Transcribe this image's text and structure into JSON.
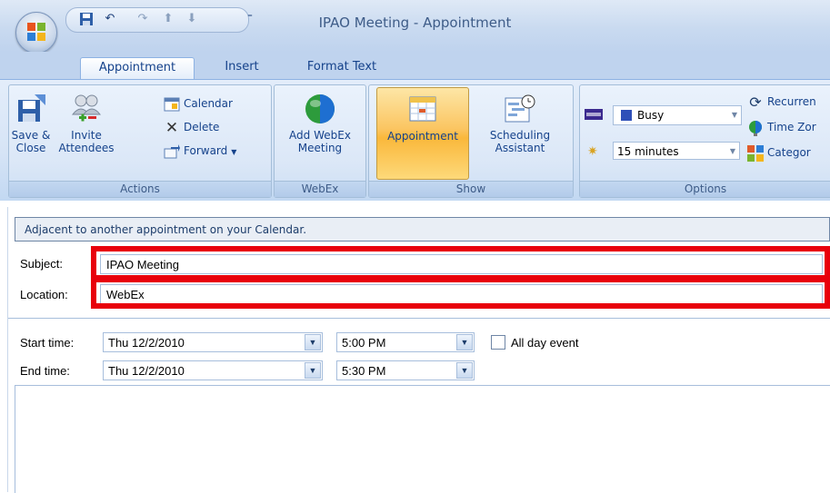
{
  "window": {
    "title": "IPAO Meeting - Appointment"
  },
  "quick_access": {
    "icons": [
      "save-icon",
      "undo-icon",
      "redo-icon",
      "up-arrow-icon",
      "down-arrow-icon",
      "customize-icon"
    ]
  },
  "tabs": [
    {
      "label": "Appointment",
      "active": true
    },
    {
      "label": "Insert"
    },
    {
      "label": "Format Text"
    }
  ],
  "ribbon": {
    "actions": {
      "label": "Actions",
      "save_close": "Save &\nClose",
      "invite_attendees": "Invite\nAttendees",
      "calendar": "Calendar",
      "delete": "Delete",
      "forward": "Forward"
    },
    "webex": {
      "label": "WebEx",
      "add_webex": "Add WebEx\nMeeting"
    },
    "show": {
      "label": "Show",
      "appointment": "Appointment",
      "scheduling": "Scheduling\nAssistant"
    },
    "options": {
      "label": "Options",
      "show_as": "Busy",
      "reminder": "15 minutes",
      "recurrence": "Recurren",
      "time_zones": "Time Zor",
      "categorize": "Categor"
    }
  },
  "infobar": {
    "text": "Adjacent to another appointment on your Calendar."
  },
  "form": {
    "subject_label": "Subject:",
    "subject_value": "IPAO Meeting",
    "location_label": "Location:",
    "location_value": "WebEx",
    "start_label": "Start time:",
    "start_date": "Thu 12/2/2010",
    "start_time": "5:00 PM",
    "end_label": "End time:",
    "end_date": "Thu 12/2/2010",
    "end_time": "5:30 PM",
    "all_day_label": "All day event",
    "all_day_checked": false
  },
  "colors": {
    "highlight": "#e8000b",
    "ribbon_bg": "#d6e4f6",
    "text_blue": "#15428b"
  }
}
